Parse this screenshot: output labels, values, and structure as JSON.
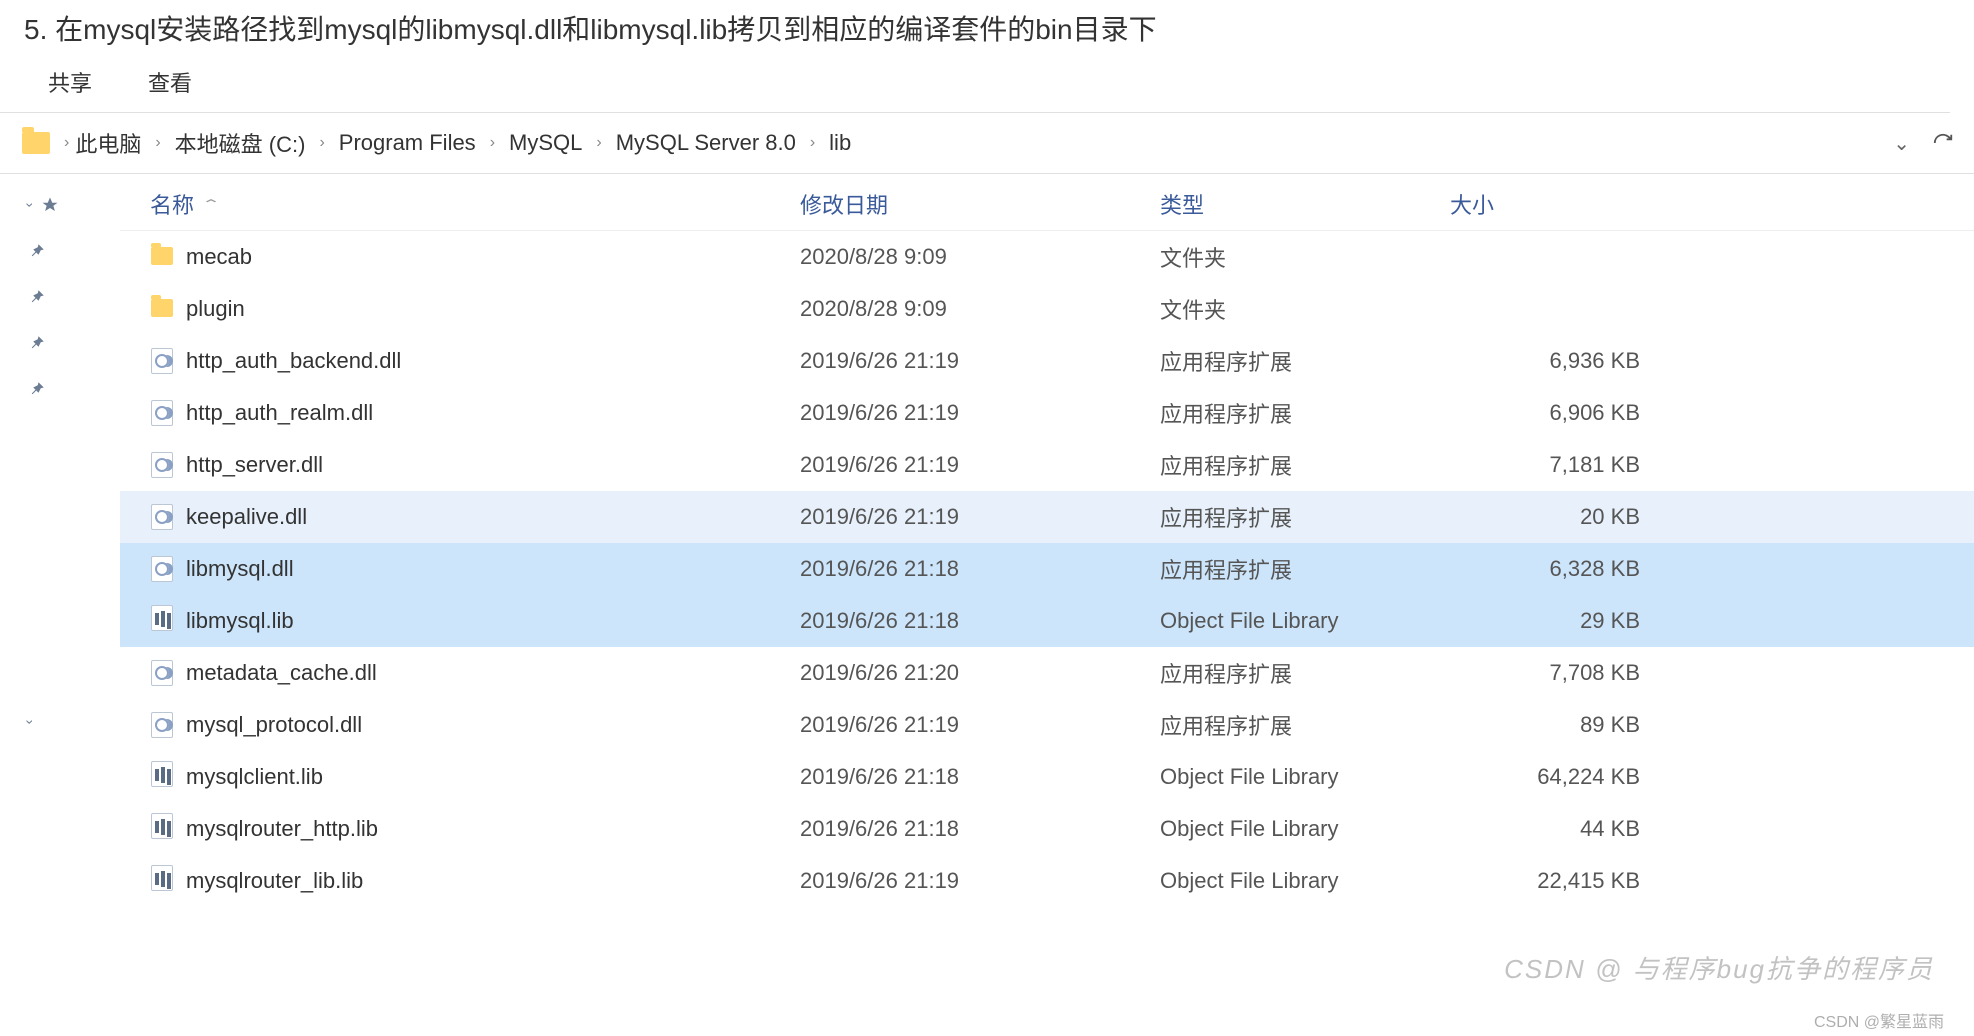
{
  "title_line": "5. 在mysql安装路径找到mysql的libmysql.dll和libmysql.lib拷贝到相应的编译套件的bin目录下",
  "toolbar": {
    "share": "共享",
    "view": "查看"
  },
  "breadcrumbs": [
    "此电脑",
    "本地磁盘 (C:)",
    "Program Files",
    "MySQL",
    "MySQL Server 8.0",
    "lib"
  ],
  "columns": {
    "name": "名称",
    "date": "修改日期",
    "type": "类型",
    "size": "大小"
  },
  "files": [
    {
      "icon": "folder",
      "name": "mecab",
      "date": "2020/8/28 9:09",
      "type": "文件夹",
      "size": "",
      "state": ""
    },
    {
      "icon": "folder",
      "name": "plugin",
      "date": "2020/8/28 9:09",
      "type": "文件夹",
      "size": "",
      "state": ""
    },
    {
      "icon": "dll",
      "name": "http_auth_backend.dll",
      "date": "2019/6/26 21:19",
      "type": "应用程序扩展",
      "size": "6,936 KB",
      "state": ""
    },
    {
      "icon": "dll",
      "name": "http_auth_realm.dll",
      "date": "2019/6/26 21:19",
      "type": "应用程序扩展",
      "size": "6,906 KB",
      "state": ""
    },
    {
      "icon": "dll",
      "name": "http_server.dll",
      "date": "2019/6/26 21:19",
      "type": "应用程序扩展",
      "size": "7,181 KB",
      "state": ""
    },
    {
      "icon": "dll",
      "name": "keepalive.dll",
      "date": "2019/6/26 21:19",
      "type": "应用程序扩展",
      "size": "20 KB",
      "state": "hover"
    },
    {
      "icon": "dll",
      "name": "libmysql.dll",
      "date": "2019/6/26 21:18",
      "type": "应用程序扩展",
      "size": "6,328 KB",
      "state": "sel"
    },
    {
      "icon": "lib",
      "name": "libmysql.lib",
      "date": "2019/6/26 21:18",
      "type": "Object File Library",
      "size": "29 KB",
      "state": "sel"
    },
    {
      "icon": "dll",
      "name": "metadata_cache.dll",
      "date": "2019/6/26 21:20",
      "type": "应用程序扩展",
      "size": "7,708 KB",
      "state": ""
    },
    {
      "icon": "dll",
      "name": "mysql_protocol.dll",
      "date": "2019/6/26 21:19",
      "type": "应用程序扩展",
      "size": "89 KB",
      "state": ""
    },
    {
      "icon": "lib",
      "name": "mysqlclient.lib",
      "date": "2019/6/26 21:18",
      "type": "Object File Library",
      "size": "64,224 KB",
      "state": ""
    },
    {
      "icon": "lib",
      "name": "mysqlrouter_http.lib",
      "date": "2019/6/26 21:18",
      "type": "Object File Library",
      "size": "44 KB",
      "state": ""
    },
    {
      "icon": "lib",
      "name": "mysqlrouter_lib.lib",
      "date": "2019/6/26 21:19",
      "type": "Object File Library",
      "size": "22,415 KB",
      "state": ""
    }
  ],
  "watermark": "CSDN @ 与程序bug抗争的程序员",
  "watermark2": "CSDN @繁星蓝雨"
}
